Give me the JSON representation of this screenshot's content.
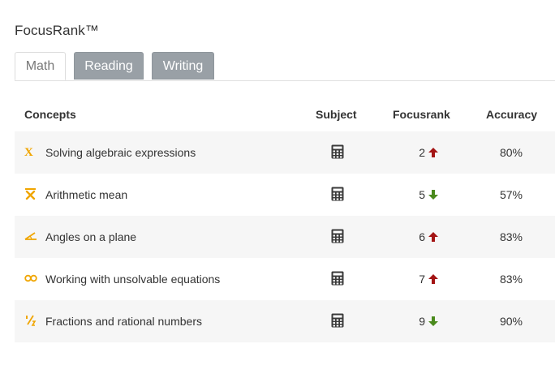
{
  "page": {
    "title": "FocusRank™"
  },
  "tabs": [
    {
      "label": "Math",
      "active": true
    },
    {
      "label": "Reading",
      "active": false
    },
    {
      "label": "Writing",
      "active": false
    }
  ],
  "table": {
    "headers": {
      "concepts": "Concepts",
      "subject": "Subject",
      "focusrank": "Focusrank",
      "accuracy": "Accuracy"
    },
    "rows": [
      {
        "icon": "variable-x-icon",
        "concept": "Solving algebraic expressions",
        "subject_icon": "calculator-icon",
        "rank": "2",
        "trend": "up",
        "accuracy": "80%"
      },
      {
        "icon": "mean-x-bar-icon",
        "concept": "Arithmetic mean",
        "subject_icon": "calculator-icon",
        "rank": "5",
        "trend": "down",
        "accuracy": "57%"
      },
      {
        "icon": "angle-icon",
        "concept": "Angles on a plane",
        "subject_icon": "calculator-icon",
        "rank": "6",
        "trend": "up",
        "accuracy": "83%"
      },
      {
        "icon": "infinity-icon",
        "concept": "Working with unsolvable equations",
        "subject_icon": "calculator-icon",
        "rank": "7",
        "trend": "up",
        "accuracy": "83%"
      },
      {
        "icon": "fraction-icon",
        "concept": "Fractions and rational numbers",
        "subject_icon": "calculator-icon",
        "rank": "9",
        "trend": "down",
        "accuracy": "90%"
      }
    ]
  },
  "colors": {
    "icon_accent": "#f0a500",
    "up": "#a31414",
    "down": "#4a8a1c",
    "tab_inactive": "#99a0a6"
  }
}
